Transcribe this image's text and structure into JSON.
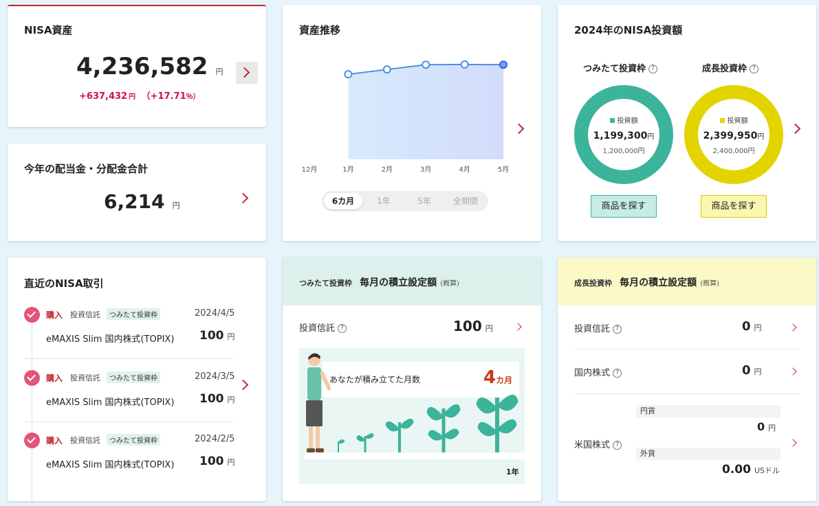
{
  "nisa_assets": {
    "title": "NISA資産",
    "total": "4,236,582",
    "yen": "円",
    "gain": "+637,432",
    "gain_yen": "円",
    "gain_pct": "（+17.71",
    "gain_pct_unit": "％）"
  },
  "dividends": {
    "title": "今年の配当金・分配金合計",
    "total": "6,214",
    "yen": "円"
  },
  "trend": {
    "title": "資産推移",
    "periods": [
      "6カ月",
      "1年",
      "5年",
      "全期間"
    ],
    "active_period": "6カ月"
  },
  "chart_data": {
    "type": "area",
    "x": [
      "12月",
      "1月",
      "2月",
      "3月",
      "4月",
      "5月"
    ],
    "y": [
      null,
      3550000,
      3750000,
      3950000,
      3960000,
      3950000
    ],
    "title": "",
    "xlabel": "",
    "ylabel": "",
    "grid": false,
    "colors": {
      "line": "#4a90e2",
      "fill_top": "#d6e8fb",
      "fill_bottom": "#d4e0fb"
    }
  },
  "investment_2024": {
    "title": "2024年のNISA投資額",
    "tsumitate": {
      "label": "つみたて投資枠",
      "legend": "投資額",
      "amount": "1,199,300",
      "yen": "円",
      "limit": "1,200,000円",
      "fraction": 0.99942,
      "color": "#3cb39b",
      "button": "商品を探す"
    },
    "growth": {
      "label": "成長投資枠",
      "legend": "投資額",
      "amount": "2,399,950",
      "yen": "円",
      "limit": "2,400,000円",
      "fraction": 0.99998,
      "color": "#e3d400",
      "button": "商品を探す"
    }
  },
  "recent_trades": {
    "title": "直近のNISA取引",
    "items": [
      {
        "type": "購入",
        "category": "投資信託",
        "frame": "つみたて投資枠",
        "date": "2024/4/5",
        "fund": "eMAXIS Slim 国内株式(TOPIX)",
        "amount": "100",
        "yen": "円"
      },
      {
        "type": "購入",
        "category": "投資信託",
        "frame": "つみたて投資枠",
        "date": "2024/3/5",
        "fund": "eMAXIS Slim 国内株式(TOPIX)",
        "amount": "100",
        "yen": "円"
      },
      {
        "type": "購入",
        "category": "投資信託",
        "frame": "つみたて投資枠",
        "date": "2024/2/5",
        "fund": "eMAXIS Slim 国内株式(TOPIX)",
        "amount": "100",
        "yen": "円"
      }
    ]
  },
  "tsumitate_monthly": {
    "frame_label": "つみたて投資枠",
    "title": "毎月の積立設定額",
    "approx": "(概算)",
    "row_label": "投資信託",
    "amount": "100",
    "yen": "円",
    "months_text": "あなたが積み立てた月数",
    "months": "4",
    "months_unit": "カ月",
    "year_label": "1年"
  },
  "growth_monthly": {
    "frame_label": "成長投資枠",
    "title": "毎月の積立設定額",
    "approx": "(概算)",
    "rows": [
      {
        "label": "投資信託",
        "amount": "0",
        "yen": "円"
      },
      {
        "label": "国内株式",
        "amount": "0",
        "yen": "円"
      }
    ],
    "us": {
      "label": "米国株式",
      "jpy_label": "円貨",
      "jpy_amount": "0",
      "jpy_unit": "円",
      "fx_label": "外貨",
      "fx_amount": "0.00",
      "fx_unit": "USドル"
    }
  }
}
